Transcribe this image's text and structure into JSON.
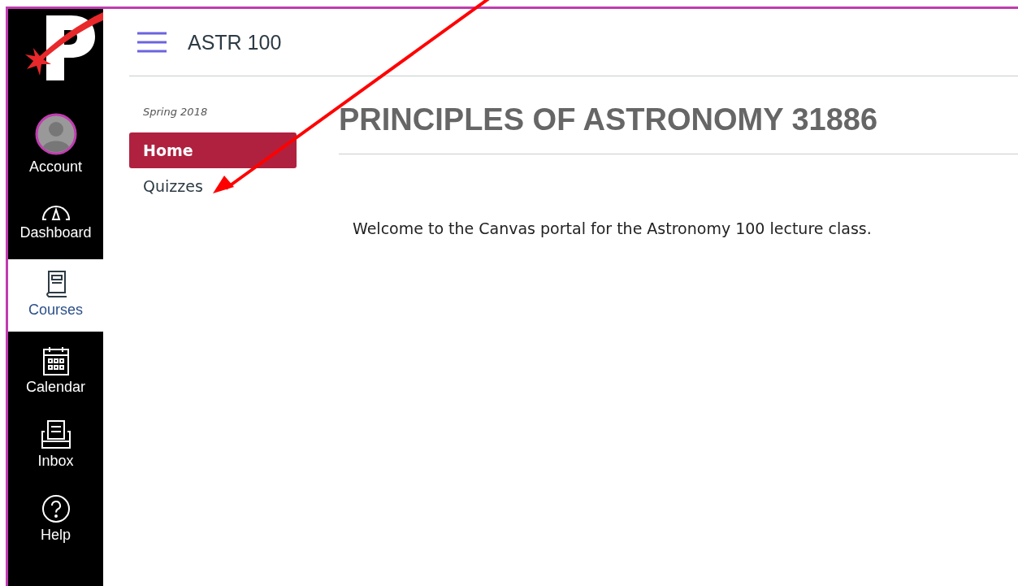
{
  "global_nav": [
    {
      "kind": "account",
      "label": "Account",
      "selected": false
    },
    {
      "kind": "dashboard",
      "label": "Dashboard",
      "selected": false
    },
    {
      "kind": "courses",
      "label": "Courses",
      "selected": true
    },
    {
      "kind": "calendar",
      "label": "Calendar",
      "selected": false
    },
    {
      "kind": "inbox",
      "label": "Inbox",
      "selected": false
    },
    {
      "kind": "help",
      "label": "Help",
      "selected": false
    }
  ],
  "header": {
    "course_code": "ASTR 100"
  },
  "course_nav": {
    "term": "Spring 2018",
    "items": [
      {
        "label": "Home",
        "selected": true
      },
      {
        "label": "Quizzes",
        "selected": false
      }
    ]
  },
  "page": {
    "heading": "PRINCIPLES OF ASTRONOMY 31886",
    "body": "Welcome to the Canvas portal for the Astronomy 100 lecture class."
  }
}
